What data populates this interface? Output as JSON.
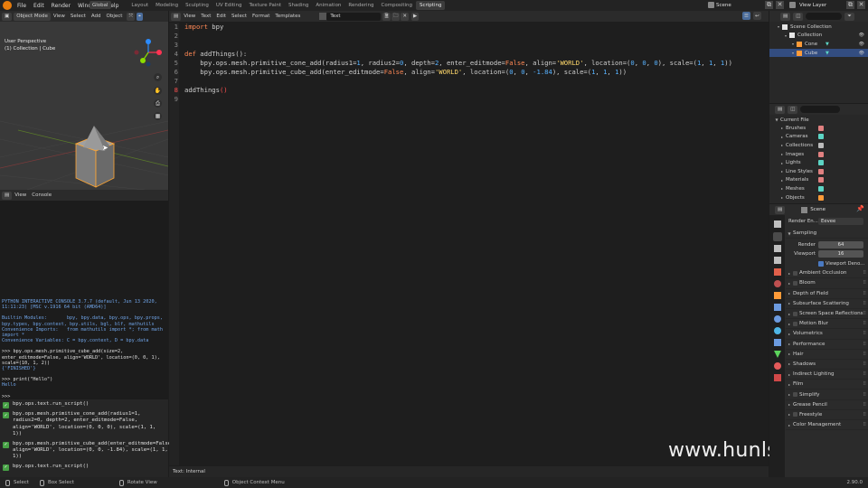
{
  "topbar": {
    "menus": [
      "File",
      "Edit",
      "Render",
      "Window",
      "Help"
    ],
    "workspaces": [
      "Layout",
      "Modeling",
      "Sculpting",
      "UV Editing",
      "Texture Paint",
      "Shading",
      "Animation",
      "Rendering",
      "Compositing",
      "Scripting"
    ],
    "active_workspace": "Scripting",
    "scene": "Scene",
    "view_layer": "View Layer"
  },
  "viewport": {
    "mode": "Object Mode",
    "menus": [
      "View",
      "Select",
      "Add",
      "Object"
    ],
    "orientation": "Global",
    "overlay_line1": "User Perspective",
    "overlay_line2": "(1) Collection | Cube",
    "colors": {
      "cube": "#8a8a8a",
      "outline": "#ffa531",
      "background": "#393939"
    }
  },
  "console": {
    "menus": [
      "View",
      "Console"
    ],
    "lines": [
      {
        "t": "PYTHON INTERACTIVE CONSOLE 3.7.7 (default, Jun 13 2020, 11:11:23) [MSC v.1916 64 bit (AMD64)]",
        "c": "blue"
      },
      {
        "t": "",
        "c": "blue"
      },
      {
        "t": "Builtin Modules:       bpy, bpy.data, bpy.ops, bpy.props, bpy.types, bpy.context, bpy.utils, bgl, blf, mathutils",
        "c": "blue"
      },
      {
        "t": "Convenience Imports:   from mathutils import *; from math import *",
        "c": "blue"
      },
      {
        "t": "Convenience Variables: C = bpy.context, D = bpy.data",
        "c": "blue"
      },
      {
        "t": "",
        "c": "blue"
      },
      {
        "t": ">>> bpy.ops.mesh.primitive_cube_add(size=2, enter_editmode=False, align='WORLD', location=(0, 0, 1), scale=(10, 1, 2))",
        "c": "white"
      },
      {
        "t": "{'FINISHED'}",
        "c": "blue"
      },
      {
        "t": "",
        "c": "blue"
      },
      {
        "t": ">>> print(\"Hello\")",
        "c": "white"
      },
      {
        "t": "Hello",
        "c": "blue"
      },
      {
        "t": "",
        "c": "blue"
      },
      {
        "t": ">>> ",
        "c": "white"
      }
    ]
  },
  "history": [
    "bpy.ops.text.run_script()",
    "bpy.ops.mesh.primitive_cone_add(radius1=1, radius2=0, depth=2, enter_editmode=False, align='WORLD', location=(0, 0, 0), scale=(1, 1, 1))",
    "bpy.ops.mesh.primitive_cube_add(enter_editmode=False, align='WORLD', location=(0, 0, -1.84), scale=(1, 1, 1))",
    "bpy.ops.text.run_script()"
  ],
  "editor": {
    "menus": [
      "View",
      "Text",
      "Edit",
      "Select",
      "Format",
      "Templates"
    ],
    "text_name": "Text",
    "footer": "Text: Internal",
    "line_numbers": [
      "1",
      "2",
      "3",
      "4",
      "5",
      "6",
      "7",
      "8",
      "9"
    ]
  },
  "outliner": {
    "items": [
      {
        "label": "Scene Collection",
        "indent": 0,
        "icon": "collection-icon"
      },
      {
        "label": "Collection",
        "indent": 1,
        "icon": "collection-icon"
      },
      {
        "label": "Cone",
        "indent": 2,
        "icon": "cone-mesh-icon"
      },
      {
        "label": "Cube",
        "indent": 2,
        "icon": "cube-mesh-icon",
        "selected": true
      }
    ]
  },
  "datablocks": {
    "header": "Current File",
    "items": [
      "Brushes",
      "Cameras",
      "Collections",
      "Images",
      "Lights",
      "Line Styles",
      "Materials",
      "Meshes",
      "Objects"
    ]
  },
  "properties": {
    "title": "Scene",
    "render_engine_label": "Render En...",
    "render_engine_value": "Eevee",
    "sampling_label": "Sampling",
    "render_label": "Render",
    "render_value": "64",
    "viewport_label": "Viewport",
    "viewport_value": "16",
    "viewport_denoise": "Viewport Deno...",
    "panels": [
      {
        "label": "Ambient Occlusion",
        "check": true
      },
      {
        "label": "Bloom",
        "check": true
      },
      {
        "label": "Depth of Field",
        "check": false
      },
      {
        "label": "Subsurface Scattering",
        "check": false
      },
      {
        "label": "Screen Space Reflections",
        "check": true
      },
      {
        "label": "Motion Blur",
        "check": true
      },
      {
        "label": "Volumetrics",
        "check": false
      },
      {
        "label": "Performance",
        "check": false
      },
      {
        "label": "Hair",
        "check": false
      },
      {
        "label": "Shadows",
        "check": false
      },
      {
        "label": "Indirect Lighting",
        "check": false
      },
      {
        "label": "Film",
        "check": false
      },
      {
        "label": "Simplify",
        "check": true
      },
      {
        "label": "Grease Pencil",
        "check": false
      },
      {
        "label": "Freestyle",
        "check": true
      },
      {
        "label": "Color Management",
        "check": false
      }
    ]
  },
  "watermark": "www.hunls.com",
  "statusbar": {
    "select": "Select",
    "box_select": "Box Select",
    "rotate_view": "Rotate View",
    "context_menu": "Object Context Menu",
    "version": "2.90.0"
  }
}
